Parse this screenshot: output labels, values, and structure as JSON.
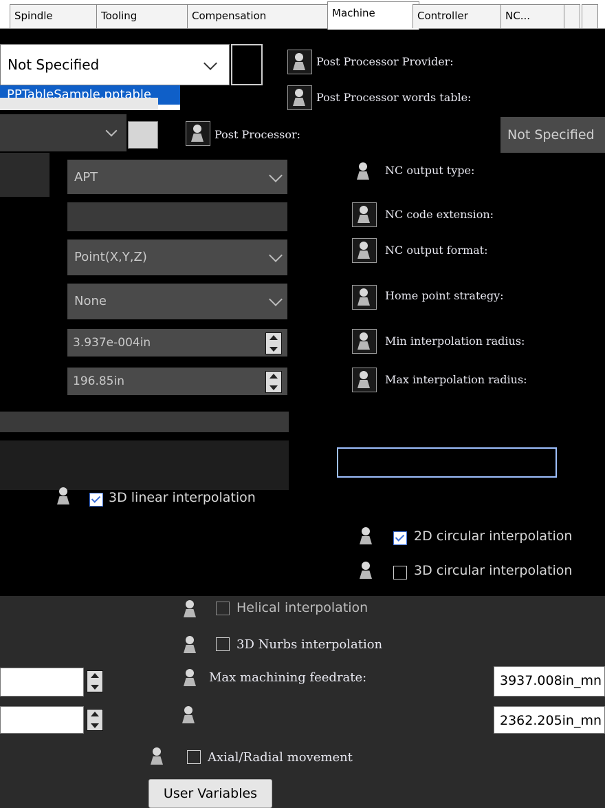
{
  "tabs": [
    "Spindle",
    "Tooling",
    "Compensation",
    "Machine",
    "Controller",
    "NC..."
  ],
  "left": {
    "post_provider_value": "Not Specified",
    "words_table_value": "PPTableSample.pptable",
    "nc_output_type_value": "APT",
    "nc_output_format_value": "Point(X,Y,Z)",
    "home_point_strategy_value": "None",
    "min_interp_radius_value": "3.937e-004in",
    "max_interp_radius_value": "196.85in"
  },
  "params": {
    "post_provider_label": "Post Processor Provider:",
    "words_table_label": "Post Processor words table:",
    "post_processor_label": "Post Processor:",
    "post_processor_value": "Not Specified",
    "nc_output_type_label": "NC output type:",
    "nc_code_ext_label": "NC code extension:",
    "nc_output_format_label": "NC output format:",
    "home_point_label": "Home point strategy:",
    "min_radius_label": "Min interpolation radius:",
    "max_radius_label": "Max interpolation radius:"
  },
  "checks": {
    "linear_3d": "3D linear interpolation",
    "circular_2d": "2D circular interpolation",
    "circular_3d": "3D circular interpolation",
    "helical": "Helical interpolation",
    "nurbs_3d": "3D Nurbs interpolation",
    "axial_radial": "Axial/Radial movement"
  },
  "feeds": {
    "max_feedrate_label": "Max machining feedrate:",
    "max_feedrate_value": "3937.008in_mn",
    "rapid_feedrate_value": "2362.205in_mn"
  },
  "user_variables_button": "User Variables"
}
